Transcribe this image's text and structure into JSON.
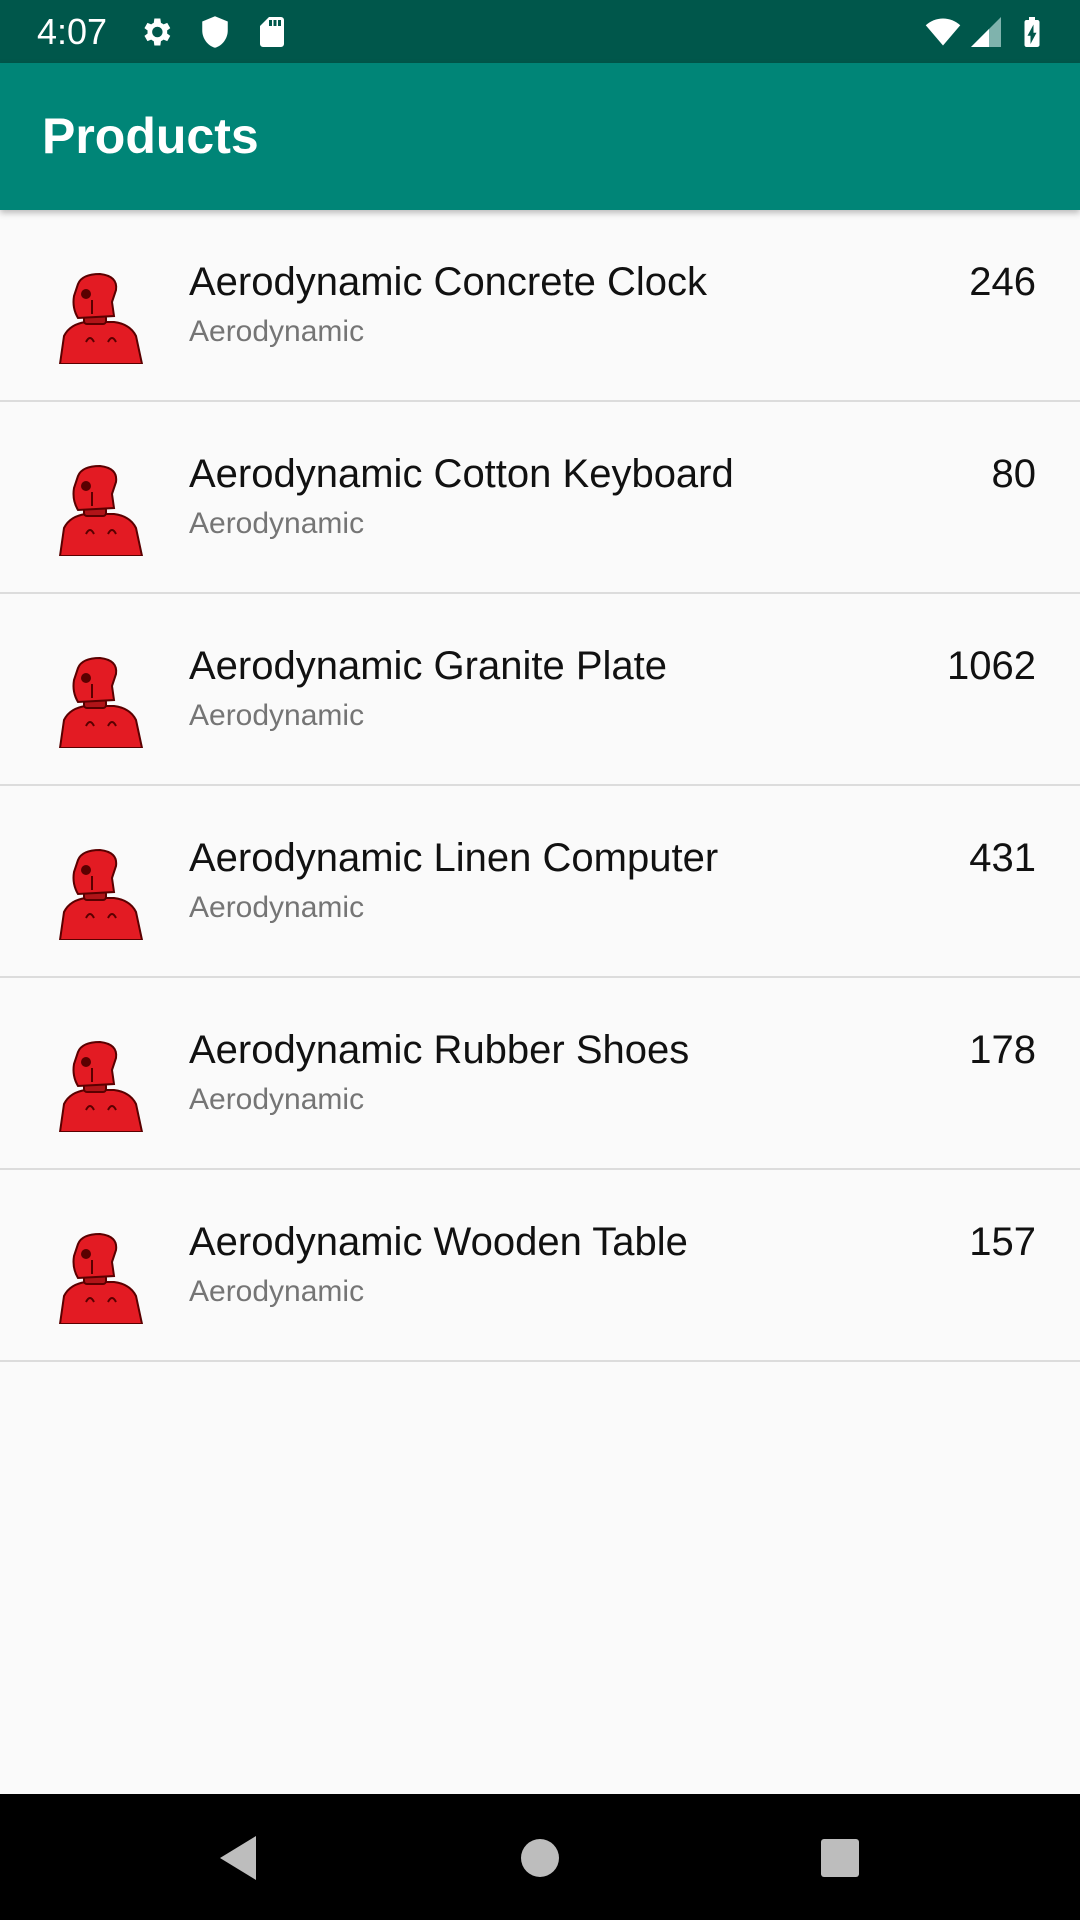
{
  "status_bar": {
    "time": "4:07",
    "left_icons": [
      "gear-icon",
      "shield-icon",
      "sd-card-icon"
    ],
    "right_icons": [
      "wifi-icon",
      "signal-icon",
      "battery-charging-icon"
    ],
    "background": "#00574b"
  },
  "app_bar": {
    "title": "Products",
    "background": "#008577"
  },
  "products": [
    {
      "title": "Aerodynamic Concrete Clock",
      "subtitle": "Aerodynamic",
      "value": "246",
      "icon": "robot-thumbnail-icon"
    },
    {
      "title": "Aerodynamic Cotton Keyboard",
      "subtitle": "Aerodynamic",
      "value": "80",
      "icon": "robot-thumbnail-icon"
    },
    {
      "title": "Aerodynamic Granite Plate",
      "subtitle": "Aerodynamic",
      "value": "1062",
      "icon": "robot-thumbnail-icon"
    },
    {
      "title": "Aerodynamic Linen Computer",
      "subtitle": "Aerodynamic",
      "value": "431",
      "icon": "robot-thumbnail-icon"
    },
    {
      "title": "Aerodynamic Rubber Shoes",
      "subtitle": "Aerodynamic",
      "value": "178",
      "icon": "robot-thumbnail-icon"
    },
    {
      "title": "Aerodynamic Wooden Table",
      "subtitle": "Aerodynamic",
      "value": "157",
      "icon": "robot-thumbnail-icon"
    }
  ],
  "nav_bar": {
    "icons": [
      "back-icon",
      "home-icon",
      "recents-icon"
    ]
  }
}
